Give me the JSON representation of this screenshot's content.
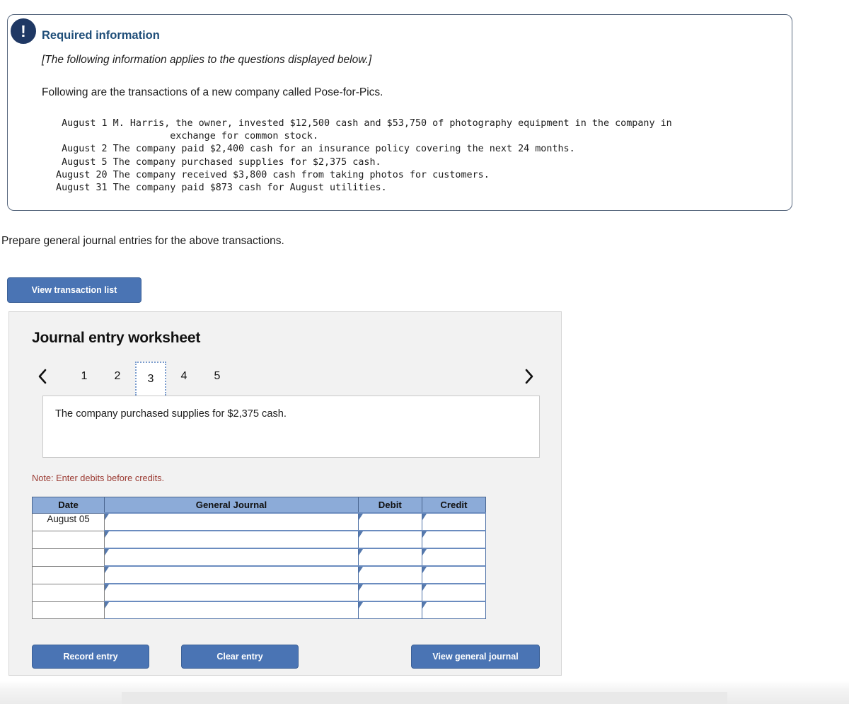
{
  "callout": {
    "icon": "exclamation-icon",
    "icon_glyph": "!",
    "title": "Required information",
    "italic_note": "[The following information applies to the questions displayed below.]",
    "lead": "Following are the transactions of a new company called Pose-for-Pics.",
    "transactions": [
      {
        "date": "August 1",
        "desc": "M. Harris, the owner, invested $12,500 cash and $53,750 of photography equipment in the company in\n          exchange for common stock."
      },
      {
        "date": "August 2",
        "desc": "The company paid $2,400 cash for an insurance policy covering the next 24 months."
      },
      {
        "date": "August 5",
        "desc": "The company purchased supplies for $2,375 cash."
      },
      {
        "date": "August 20",
        "desc": "The company received $3,800 cash from taking photos for customers."
      },
      {
        "date": "August 31",
        "desc": "The company paid $873 cash for August utilities."
      }
    ]
  },
  "instruction": "Prepare general journal entries for the above transactions.",
  "view_transaction_list_label": "View transaction list",
  "worksheet": {
    "title": "Journal entry worksheet",
    "pager": {
      "prev_icon": "chevron-left-icon",
      "next_icon": "chevron-right-icon",
      "pages": [
        "1",
        "2",
        "3",
        "4",
        "5"
      ],
      "selected": "3"
    },
    "prompt": "The company purchased supplies for $2,375 cash.",
    "note": "Note: Enter debits before credits.",
    "table": {
      "headers": [
        "Date",
        "General Journal",
        "Debit",
        "Credit"
      ],
      "rows": [
        {
          "date": "August 05",
          "general_journal": "",
          "debit": "",
          "credit": ""
        },
        {
          "date": "",
          "general_journal": "",
          "debit": "",
          "credit": ""
        },
        {
          "date": "",
          "general_journal": "",
          "debit": "",
          "credit": ""
        },
        {
          "date": "",
          "general_journal": "",
          "debit": "",
          "credit": ""
        },
        {
          "date": "",
          "general_journal": "",
          "debit": "",
          "credit": ""
        },
        {
          "date": "",
          "general_journal": "",
          "debit": "",
          "credit": ""
        }
      ]
    },
    "buttons": {
      "record_entry": "Record entry",
      "clear_entry": "Clear entry",
      "view_general_journal": "View general journal"
    }
  },
  "colors": {
    "accent_blue": "#4a74b4",
    "title_blue": "#1f4e79",
    "icon_navy": "#1f3864",
    "table_header_blue": "#8cabd8",
    "note_red": "#9b3a32",
    "panel_gray": "#f2f2f2"
  }
}
